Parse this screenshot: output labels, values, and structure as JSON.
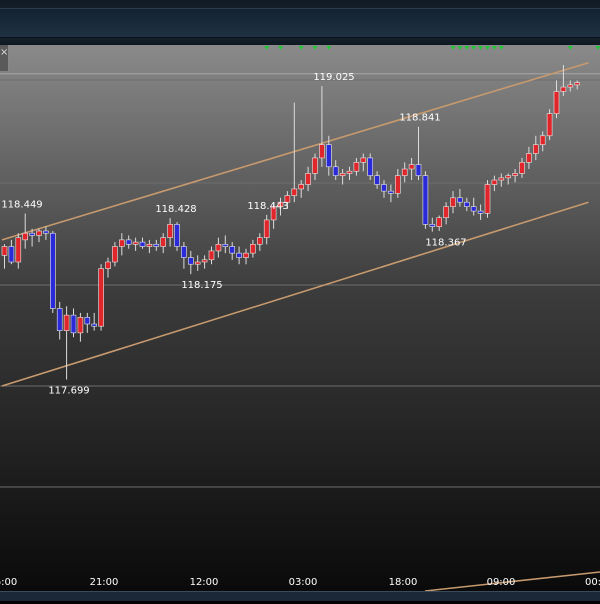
{
  "close_button": {
    "label": "×",
    "icon": "close-icon"
  },
  "chart_data": {
    "type": "candlestick",
    "ylim": [
      116.83,
      119.21
    ],
    "grid": true,
    "legend": "none",
    "x_ticks": [
      "6:00",
      "21:00",
      "12:00",
      "03:00",
      "18:00",
      "09:00",
      "00:"
    ],
    "price_labels": [
      {
        "text": "118.449",
        "value": 118.449,
        "type": "high"
      },
      {
        "text": "117.699",
        "value": 117.699,
        "type": "low"
      },
      {
        "text": "118.428",
        "value": 118.428,
        "type": "high"
      },
      {
        "text": "118.175",
        "value": 118.175,
        "type": "low"
      },
      {
        "text": "118.443",
        "value": 118.443,
        "type": "high"
      },
      {
        "text": "119.025",
        "value": 119.025,
        "type": "high"
      },
      {
        "text": "118.841",
        "value": 118.841,
        "type": "high"
      },
      {
        "text": "118.367",
        "value": 118.367,
        "type": "low"
      }
    ],
    "candles": [
      {
        "o": 118.26,
        "h": 118.31,
        "l": 118.2,
        "c": 118.3,
        "dir": "up"
      },
      {
        "o": 118.3,
        "h": 118.33,
        "l": 118.22,
        "c": 118.23,
        "dir": "down"
      },
      {
        "o": 118.23,
        "h": 118.36,
        "l": 118.2,
        "c": 118.34,
        "dir": "up"
      },
      {
        "o": 118.33,
        "h": 118.449,
        "l": 118.29,
        "c": 118.36,
        "dir": "up"
      },
      {
        "o": 118.36,
        "h": 118.38,
        "l": 118.3,
        "c": 118.35,
        "dir": "down"
      },
      {
        "o": 118.35,
        "h": 118.38,
        "l": 118.32,
        "c": 118.37,
        "dir": "up"
      },
      {
        "o": 118.37,
        "h": 118.39,
        "l": 118.33,
        "c": 118.36,
        "dir": "down"
      },
      {
        "o": 118.36,
        "h": 118.37,
        "l": 118.0,
        "c": 118.02,
        "dir": "down"
      },
      {
        "o": 118.02,
        "h": 118.05,
        "l": 117.88,
        "c": 117.92,
        "dir": "down"
      },
      {
        "o": 117.92,
        "h": 118.03,
        "l": 117.699,
        "c": 117.99,
        "dir": "up"
      },
      {
        "o": 117.99,
        "h": 118.02,
        "l": 117.89,
        "c": 117.91,
        "dir": "down"
      },
      {
        "o": 117.91,
        "h": 118.0,
        "l": 117.87,
        "c": 117.98,
        "dir": "up"
      },
      {
        "o": 117.98,
        "h": 118.0,
        "l": 117.91,
        "c": 117.95,
        "dir": "down"
      },
      {
        "o": 117.95,
        "h": 118.0,
        "l": 117.92,
        "c": 117.94,
        "dir": "down"
      },
      {
        "o": 117.94,
        "h": 118.22,
        "l": 117.92,
        "c": 118.2,
        "dir": "up"
      },
      {
        "o": 118.2,
        "h": 118.25,
        "l": 118.16,
        "c": 118.23,
        "dir": "up"
      },
      {
        "o": 118.23,
        "h": 118.32,
        "l": 118.21,
        "c": 118.3,
        "dir": "up"
      },
      {
        "o": 118.3,
        "h": 118.36,
        "l": 118.26,
        "c": 118.33,
        "dir": "up"
      },
      {
        "o": 118.33,
        "h": 118.35,
        "l": 118.29,
        "c": 118.31,
        "dir": "down"
      },
      {
        "o": 118.31,
        "h": 118.34,
        "l": 118.28,
        "c": 118.32,
        "dir": "up"
      },
      {
        "o": 118.32,
        "h": 118.34,
        "l": 118.29,
        "c": 118.3,
        "dir": "down"
      },
      {
        "o": 118.3,
        "h": 118.33,
        "l": 118.27,
        "c": 118.31,
        "dir": "up"
      },
      {
        "o": 118.31,
        "h": 118.33,
        "l": 118.28,
        "c": 118.3,
        "dir": "down"
      },
      {
        "o": 118.3,
        "h": 118.36,
        "l": 118.27,
        "c": 118.34,
        "dir": "up"
      },
      {
        "o": 118.34,
        "h": 118.428,
        "l": 118.3,
        "c": 118.4,
        "dir": "up"
      },
      {
        "o": 118.4,
        "h": 118.41,
        "l": 118.28,
        "c": 118.3,
        "dir": "down"
      },
      {
        "o": 118.3,
        "h": 118.32,
        "l": 118.2,
        "c": 118.25,
        "dir": "down"
      },
      {
        "o": 118.25,
        "h": 118.28,
        "l": 118.175,
        "c": 118.22,
        "dir": "down"
      },
      {
        "o": 118.22,
        "h": 118.26,
        "l": 118.19,
        "c": 118.23,
        "dir": "up"
      },
      {
        "o": 118.23,
        "h": 118.26,
        "l": 118.2,
        "c": 118.24,
        "dir": "up"
      },
      {
        "o": 118.24,
        "h": 118.3,
        "l": 118.22,
        "c": 118.28,
        "dir": "up"
      },
      {
        "o": 118.28,
        "h": 118.34,
        "l": 118.25,
        "c": 118.31,
        "dir": "up"
      },
      {
        "o": 118.31,
        "h": 118.35,
        "l": 118.27,
        "c": 118.3,
        "dir": "down"
      },
      {
        "o": 118.3,
        "h": 118.32,
        "l": 118.24,
        "c": 118.27,
        "dir": "down"
      },
      {
        "o": 118.27,
        "h": 118.3,
        "l": 118.22,
        "c": 118.25,
        "dir": "down"
      },
      {
        "o": 118.25,
        "h": 118.29,
        "l": 118.22,
        "c": 118.27,
        "dir": "up"
      },
      {
        "o": 118.27,
        "h": 118.33,
        "l": 118.25,
        "c": 118.31,
        "dir": "up"
      },
      {
        "o": 118.31,
        "h": 118.36,
        "l": 118.28,
        "c": 118.34,
        "dir": "up"
      },
      {
        "o": 118.34,
        "h": 118.443,
        "l": 118.31,
        "c": 118.42,
        "dir": "up"
      },
      {
        "o": 118.42,
        "h": 118.5,
        "l": 118.38,
        "c": 118.48,
        "dir": "up"
      },
      {
        "o": 118.48,
        "h": 118.52,
        "l": 118.44,
        "c": 118.5,
        "dir": "up"
      },
      {
        "o": 118.5,
        "h": 118.55,
        "l": 118.47,
        "c": 118.53,
        "dir": "up"
      },
      {
        "o": 118.53,
        "h": 118.95,
        "l": 118.5,
        "c": 118.56,
        "dir": "up"
      },
      {
        "o": 118.56,
        "h": 118.6,
        "l": 118.52,
        "c": 118.58,
        "dir": "up"
      },
      {
        "o": 118.58,
        "h": 118.66,
        "l": 118.55,
        "c": 118.63,
        "dir": "up"
      },
      {
        "o": 118.63,
        "h": 118.72,
        "l": 118.6,
        "c": 118.7,
        "dir": "up"
      },
      {
        "o": 118.7,
        "h": 119.025,
        "l": 118.66,
        "c": 118.76,
        "dir": "up"
      },
      {
        "o": 118.76,
        "h": 118.8,
        "l": 118.62,
        "c": 118.66,
        "dir": "down"
      },
      {
        "o": 118.66,
        "h": 118.69,
        "l": 118.6,
        "c": 118.62,
        "dir": "down"
      },
      {
        "o": 118.62,
        "h": 118.65,
        "l": 118.58,
        "c": 118.63,
        "dir": "up"
      },
      {
        "o": 118.63,
        "h": 118.66,
        "l": 118.6,
        "c": 118.64,
        "dir": "up"
      },
      {
        "o": 118.64,
        "h": 118.7,
        "l": 118.62,
        "c": 118.68,
        "dir": "up"
      },
      {
        "o": 118.68,
        "h": 118.72,
        "l": 118.64,
        "c": 118.7,
        "dir": "up"
      },
      {
        "o": 118.7,
        "h": 118.72,
        "l": 118.6,
        "c": 118.62,
        "dir": "down"
      },
      {
        "o": 118.62,
        "h": 118.64,
        "l": 118.56,
        "c": 118.58,
        "dir": "down"
      },
      {
        "o": 118.58,
        "h": 118.6,
        "l": 118.52,
        "c": 118.55,
        "dir": "down"
      },
      {
        "o": 118.55,
        "h": 118.58,
        "l": 118.5,
        "c": 118.54,
        "dir": "down"
      },
      {
        "o": 118.54,
        "h": 118.65,
        "l": 118.52,
        "c": 118.62,
        "dir": "up"
      },
      {
        "o": 118.62,
        "h": 118.68,
        "l": 118.59,
        "c": 118.65,
        "dir": "up"
      },
      {
        "o": 118.65,
        "h": 118.7,
        "l": 118.6,
        "c": 118.67,
        "dir": "up"
      },
      {
        "o": 118.67,
        "h": 118.841,
        "l": 118.6,
        "c": 118.62,
        "dir": "down"
      },
      {
        "o": 118.62,
        "h": 118.64,
        "l": 118.38,
        "c": 118.4,
        "dir": "down"
      },
      {
        "o": 118.4,
        "h": 118.43,
        "l": 118.367,
        "c": 118.39,
        "dir": "down"
      },
      {
        "o": 118.39,
        "h": 118.44,
        "l": 118.37,
        "c": 118.43,
        "dir": "up"
      },
      {
        "o": 118.43,
        "h": 118.5,
        "l": 118.4,
        "c": 118.48,
        "dir": "up"
      },
      {
        "o": 118.48,
        "h": 118.55,
        "l": 118.45,
        "c": 118.52,
        "dir": "up"
      },
      {
        "o": 118.52,
        "h": 118.56,
        "l": 118.48,
        "c": 118.5,
        "dir": "down"
      },
      {
        "o": 118.5,
        "h": 118.52,
        "l": 118.46,
        "c": 118.48,
        "dir": "down"
      },
      {
        "o": 118.48,
        "h": 118.52,
        "l": 118.44,
        "c": 118.46,
        "dir": "down"
      },
      {
        "o": 118.46,
        "h": 118.49,
        "l": 118.42,
        "c": 118.45,
        "dir": "down"
      },
      {
        "o": 118.45,
        "h": 118.6,
        "l": 118.43,
        "c": 118.58,
        "dir": "up"
      },
      {
        "o": 118.58,
        "h": 118.62,
        "l": 118.55,
        "c": 118.6,
        "dir": "up"
      },
      {
        "o": 118.6,
        "h": 118.63,
        "l": 118.57,
        "c": 118.61,
        "dir": "up"
      },
      {
        "o": 118.61,
        "h": 118.63,
        "l": 118.58,
        "c": 118.62,
        "dir": "up"
      },
      {
        "o": 118.62,
        "h": 118.65,
        "l": 118.59,
        "c": 118.63,
        "dir": "up"
      },
      {
        "o": 118.63,
        "h": 118.7,
        "l": 118.61,
        "c": 118.68,
        "dir": "up"
      },
      {
        "o": 118.68,
        "h": 118.75,
        "l": 118.65,
        "c": 118.72,
        "dir": "up"
      },
      {
        "o": 118.72,
        "h": 118.8,
        "l": 118.69,
        "c": 118.76,
        "dir": "up"
      },
      {
        "o": 118.76,
        "h": 118.82,
        "l": 118.73,
        "c": 118.8,
        "dir": "up"
      },
      {
        "o": 118.8,
        "h": 118.92,
        "l": 118.78,
        "c": 118.9,
        "dir": "up"
      },
      {
        "o": 118.9,
        "h": 119.05,
        "l": 118.88,
        "c": 119.0,
        "dir": "up"
      },
      {
        "o": 119.0,
        "h": 119.12,
        "l": 118.98,
        "c": 119.02,
        "dir": "up"
      },
      {
        "o": 119.02,
        "h": 119.05,
        "l": 119.0,
        "c": 119.03,
        "dir": "up"
      },
      {
        "o": 119.03,
        "h": 119.05,
        "l": 119.01,
        "c": 119.04,
        "dir": "up"
      }
    ],
    "trendlines": [
      {
        "name": "upper channel",
        "from": {
          "bar": 0,
          "price": 118.33
        },
        "to": {
          "bar": 85,
          "price": 119.13
        }
      },
      {
        "name": "lower channel",
        "from": {
          "bar": 0,
          "price": 117.67
        },
        "to": {
          "bar": 85,
          "price": 118.5
        }
      }
    ],
    "current_price_line": 119.08,
    "signal_marker_bars": [
      38,
      40,
      43,
      45,
      47,
      65,
      66,
      67,
      68,
      69,
      70,
      71,
      72,
      82,
      86,
      88,
      92,
      94,
      96
    ]
  },
  "colors": {
    "bull": "#e0262a",
    "bear": "#2a2ad8",
    "trendline": "#c79a6e",
    "label": "#ffffff",
    "signal": "#22c534",
    "grid": "#6e6e6e"
  }
}
